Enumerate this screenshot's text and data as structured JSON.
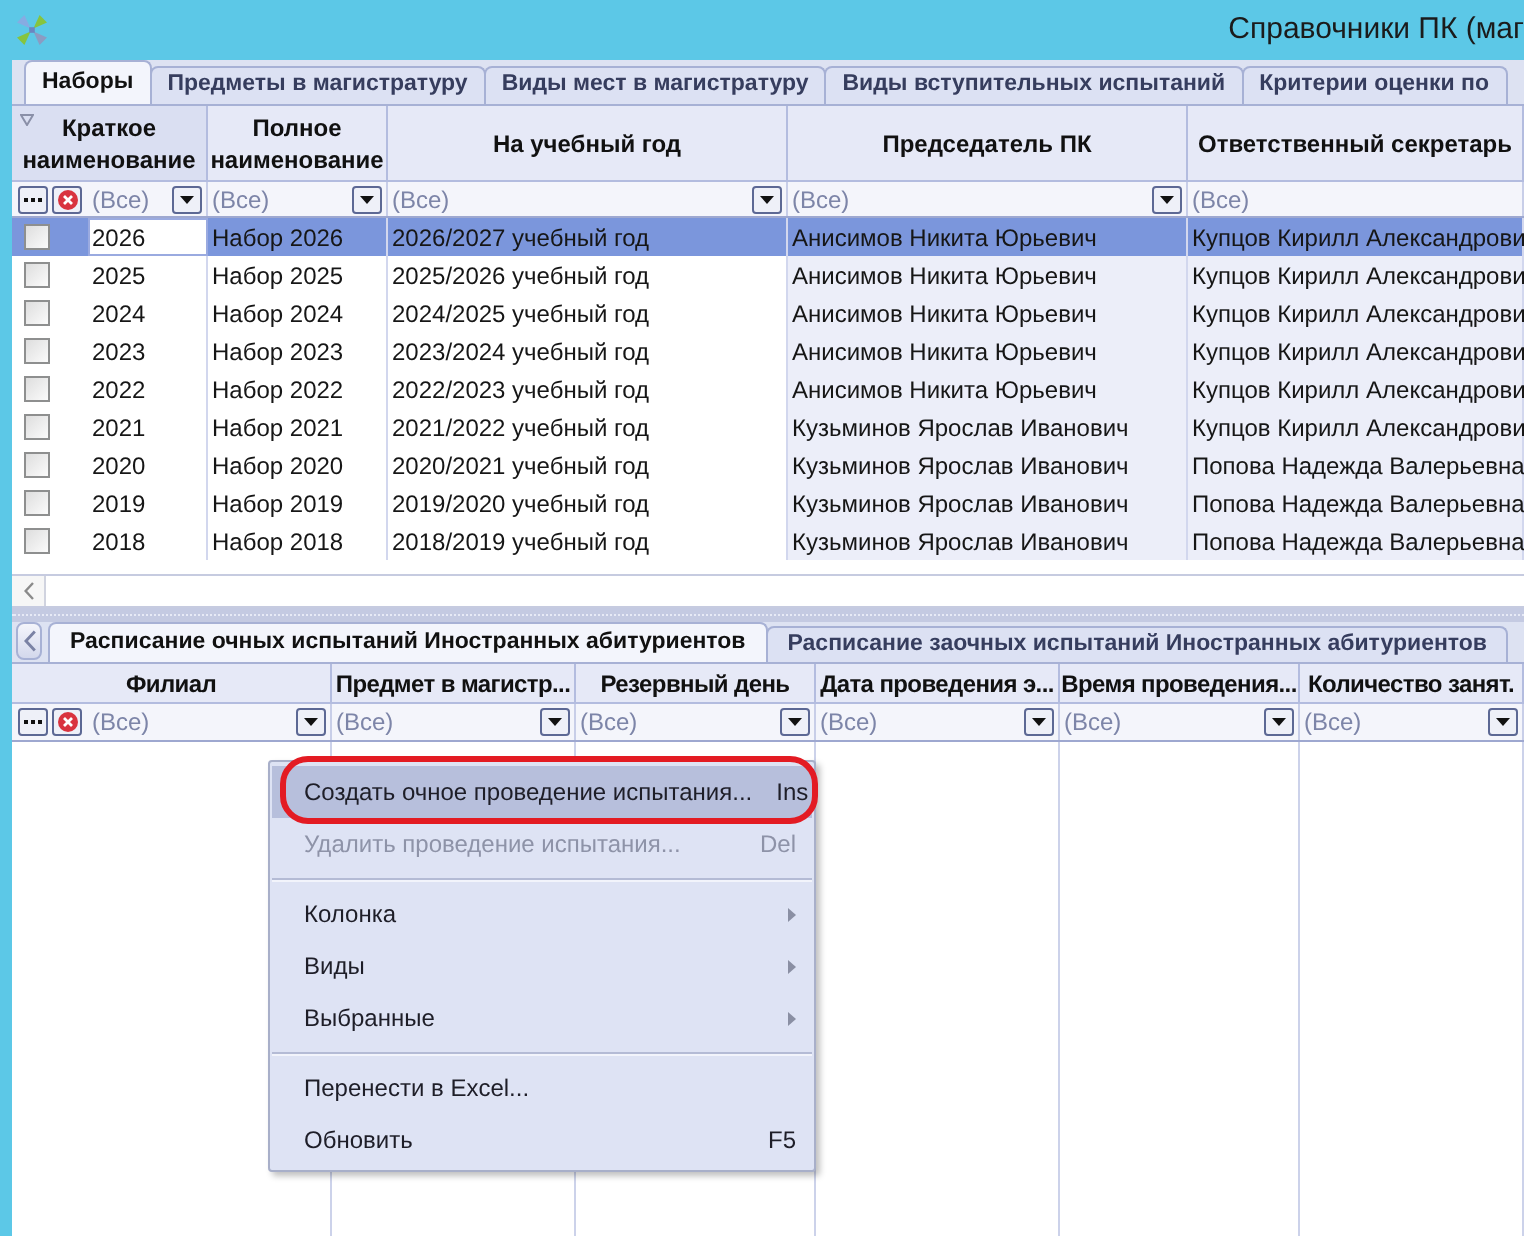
{
  "window": {
    "title": "Справочники ПК (маг"
  },
  "tabs": [
    {
      "label": "Наборы",
      "selected": true
    },
    {
      "label": "Предметы в магистратуру",
      "selected": false
    },
    {
      "label": "Виды мест в магистратуру",
      "selected": false
    },
    {
      "label": "Виды вступительных испытаний",
      "selected": false
    },
    {
      "label": "Критерии оценки по",
      "selected": false
    }
  ],
  "grid": {
    "columns": [
      {
        "label": "Краткое наименование",
        "filter": "(Все)",
        "readonly": false
      },
      {
        "label": "Полное наименование",
        "filter": "(Все)",
        "readonly": false
      },
      {
        "label": "На учебный год",
        "filter": "(Все)",
        "readonly": false
      },
      {
        "label": "Председатель ПК",
        "filter": "(Все)",
        "readonly": true
      },
      {
        "label": "Ответственный секретарь",
        "filter": "(Все)",
        "readonly": true
      }
    ],
    "rows": [
      {
        "selected": true,
        "checked": false,
        "cells": [
          {
            "text": "2026",
            "focused": true
          },
          {
            "text": "Набор 2026",
            "focused": false
          },
          {
            "text": "2026/2027 учебный год",
            "focused": false
          },
          {
            "text": "Анисимов Никита Юрьевич",
            "focused": false
          },
          {
            "text": "Купцов Кирилл Александрови",
            "focused": false
          }
        ]
      },
      {
        "selected": false,
        "checked": false,
        "cells": [
          {
            "text": "2025",
            "focused": false
          },
          {
            "text": "Набор 2025",
            "focused": false
          },
          {
            "text": "2025/2026 учебный год",
            "focused": false
          },
          {
            "text": "Анисимов Никита Юрьевич",
            "focused": false
          },
          {
            "text": "Купцов Кирилл Александрови",
            "focused": false
          }
        ]
      },
      {
        "selected": false,
        "checked": false,
        "cells": [
          {
            "text": "2024",
            "focused": false
          },
          {
            "text": "Набор 2024",
            "focused": false
          },
          {
            "text": "2024/2025 учебный год",
            "focused": false
          },
          {
            "text": "Анисимов Никита Юрьевич",
            "focused": false
          },
          {
            "text": "Купцов Кирилл Александрови",
            "focused": false
          }
        ]
      },
      {
        "selected": false,
        "checked": false,
        "cells": [
          {
            "text": "2023",
            "focused": false
          },
          {
            "text": "Набор 2023",
            "focused": false
          },
          {
            "text": "2023/2024 учебный год",
            "focused": false
          },
          {
            "text": "Анисимов Никита Юрьевич",
            "focused": false
          },
          {
            "text": "Купцов Кирилл Александрови",
            "focused": false
          }
        ]
      },
      {
        "selected": false,
        "checked": false,
        "cells": [
          {
            "text": "2022",
            "focused": false
          },
          {
            "text": "Набор 2022",
            "focused": false
          },
          {
            "text": "2022/2023 учебный год",
            "focused": false
          },
          {
            "text": "Анисимов Никита Юрьевич",
            "focused": false
          },
          {
            "text": "Купцов Кирилл Александрови",
            "focused": false
          }
        ]
      },
      {
        "selected": false,
        "checked": false,
        "cells": [
          {
            "text": "2021",
            "focused": false
          },
          {
            "text": "Набор 2021",
            "focused": false
          },
          {
            "text": "2021/2022 учебный год",
            "focused": false
          },
          {
            "text": "Кузьминов Ярослав Иванович",
            "focused": false
          },
          {
            "text": "Купцов Кирилл Александрови",
            "focused": false
          }
        ]
      },
      {
        "selected": false,
        "checked": false,
        "cells": [
          {
            "text": "2020",
            "focused": false
          },
          {
            "text": "Набор 2020",
            "focused": false
          },
          {
            "text": "2020/2021 учебный год",
            "focused": false
          },
          {
            "text": "Кузьминов Ярослав Иванович",
            "focused": false
          },
          {
            "text": "Попова Надежда Валерьевна",
            "focused": false
          }
        ]
      },
      {
        "selected": false,
        "checked": false,
        "cells": [
          {
            "text": "2019",
            "focused": false
          },
          {
            "text": "Набор 2019",
            "focused": false
          },
          {
            "text": "2019/2020 учебный год",
            "focused": false
          },
          {
            "text": "Кузьминов Ярослав Иванович",
            "focused": false
          },
          {
            "text": "Попова Надежда Валерьевна",
            "focused": false
          }
        ]
      },
      {
        "selected": false,
        "checked": false,
        "cells": [
          {
            "text": "2018",
            "focused": false
          },
          {
            "text": "Набор 2018",
            "focused": false
          },
          {
            "text": "2018/2019 учебный год",
            "focused": false
          },
          {
            "text": "Кузьминов Ярослав Иванович",
            "focused": false
          },
          {
            "text": "Попова Надежда Валерьевна",
            "focused": false
          }
        ]
      }
    ]
  },
  "detail": {
    "tabs": [
      {
        "label": "Расписание очных испытаний Иностранных абитуриентов",
        "selected": true
      },
      {
        "label": "Расписание заочных испытаний Иностранных абитуриентов",
        "selected": false
      }
    ],
    "columns": [
      {
        "label": "Филиал",
        "filter": "(Все)"
      },
      {
        "label": "Предмет в магистр...",
        "filter": "(Все)"
      },
      {
        "label": "Резервный день",
        "filter": "(Все)"
      },
      {
        "label": "Дата проведения э...",
        "filter": "(Все)"
      },
      {
        "label": "Время проведения...",
        "filter": "(Все)"
      },
      {
        "label": "Количество занят.",
        "filter": "(Все)"
      }
    ]
  },
  "context_menu": {
    "items": [
      {
        "kind": "action",
        "label": "Создать очное проведение испытания...",
        "shortcut": "Ins",
        "disabled": false,
        "selected": true,
        "circled": true
      },
      {
        "kind": "action",
        "label": "Удалить проведение испытания...",
        "shortcut": "Del",
        "disabled": true,
        "selected": false,
        "circled": false
      },
      {
        "kind": "separator"
      },
      {
        "kind": "submenu",
        "label": "Колонка",
        "disabled": false,
        "selected": false,
        "circled": false
      },
      {
        "kind": "submenu",
        "label": "Виды",
        "disabled": false,
        "selected": false,
        "circled": false
      },
      {
        "kind": "submenu",
        "label": "Выбранные",
        "disabled": false,
        "selected": false,
        "circled": false
      },
      {
        "kind": "separator"
      },
      {
        "kind": "action",
        "label": "Перенести в Excel...",
        "disabled": false,
        "selected": false,
        "circled": false
      },
      {
        "kind": "action",
        "label": "Обновить",
        "shortcut": "F5",
        "disabled": false,
        "selected": false,
        "circled": false
      }
    ]
  }
}
